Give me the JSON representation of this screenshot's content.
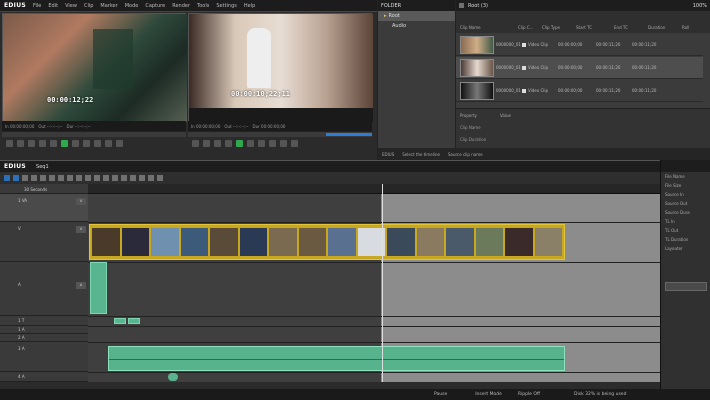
{
  "app": {
    "logo": "EDIUS"
  },
  "menu": [
    "File",
    "Edit",
    "View",
    "Clip",
    "Marker",
    "Mode",
    "Capture",
    "Render",
    "Tools",
    "Settings",
    "Help"
  ],
  "player": {
    "timecode": "00:00:12;22",
    "in": "In 00:00:00;00",
    "out": "Out --:--:--;--",
    "dur": "Dur --:--:--;--"
  },
  "recorder": {
    "timecode": "00:00:10;22;11",
    "in": "In 00:00:00;00",
    "out": "Out --:--:--;--",
    "dur": "Dur 00:00:00;00"
  },
  "folder_panel": {
    "title": "FOLDER",
    "items": [
      "Root",
      "Audio"
    ]
  },
  "bin": {
    "tab": "Root (3)",
    "zoom": "100%",
    "columns": [
      "Clip Name",
      "Clip C...",
      "Clip Type",
      "Start TC",
      "End TC",
      "Duration",
      "Roll"
    ],
    "rows": [
      {
        "name": "0000000_01",
        "type": "Video Clip",
        "start": "00:00:00;00",
        "end": "00:00:11;20",
        "dur": "00:00:11;20"
      },
      {
        "name": "0000000_01",
        "type": "Video Clip",
        "start": "00:00:00;00",
        "end": "00:00:11;20",
        "dur": "00:00:11;20"
      },
      {
        "name": "0000000_01",
        "type": "Video Clip",
        "start": "00:00:00;00",
        "end": "00:00:11;20",
        "dur": "00:00:11;20"
      }
    ]
  },
  "properties": {
    "label": "Property",
    "value": "Value",
    "field1": "Clip Name",
    "field2": "Clip Duration"
  },
  "bin_footer": [
    "EDIUS",
    "Select the timeline",
    "Source clip name"
  ],
  "timeline": {
    "logo": "EDIUS",
    "sequence": "Seq1",
    "tracks": [
      {
        "id": "1 VA",
        "label": "1 VA"
      },
      {
        "id": "V",
        "label": "V"
      },
      {
        "id": "A",
        "label": "A"
      },
      {
        "id": "1 T",
        "label": "1 T"
      },
      {
        "id": "1 A",
        "label": "1 A"
      },
      {
        "id": "2 A",
        "label": "2 A"
      },
      {
        "id": "3 A",
        "label": "3 A"
      },
      {
        "id": "4 A",
        "label": "4 A"
      }
    ],
    "scale": "30 Seconds"
  },
  "info_panel": {
    "rows": [
      "File Name",
      "File Size",
      "Source In",
      "Source Out",
      "Source Dura",
      "TL In",
      "TL Out",
      "TL Duration",
      "Layouter"
    ]
  },
  "status": {
    "left": "Pause",
    "mid1": "Insert Mode",
    "mid2": "Ripple Off",
    "right": "Disk 32% is being used"
  }
}
